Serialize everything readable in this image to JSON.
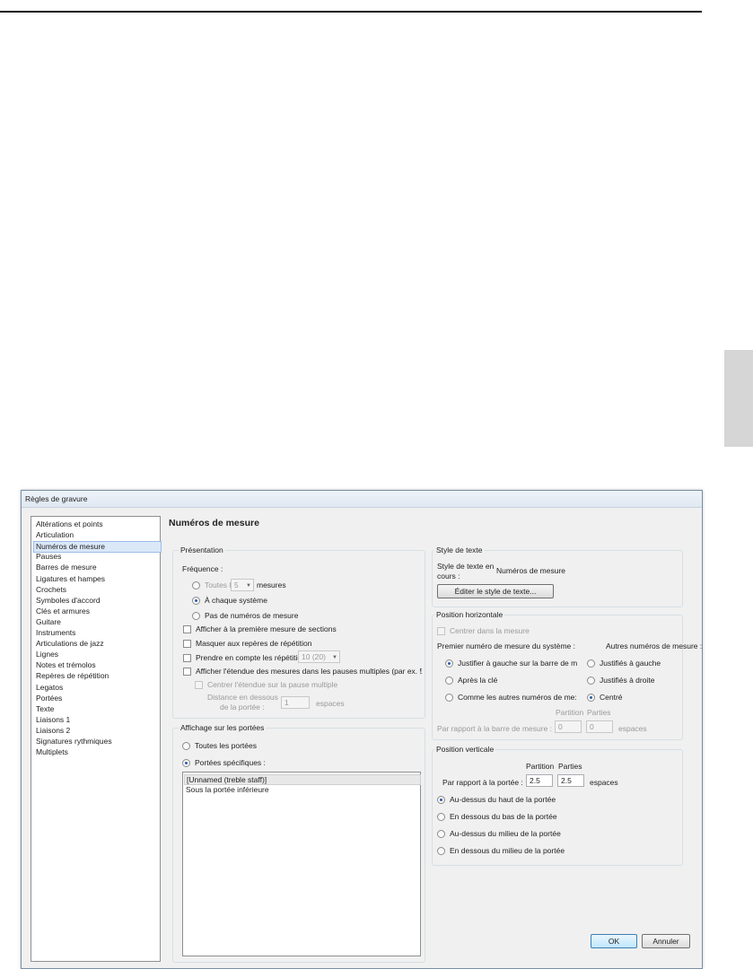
{
  "window": {
    "title": "Règles de gravure"
  },
  "nav": {
    "items": [
      "Altérations et points",
      "Articulation",
      "Numéros de mesure",
      "Pauses",
      "Barres de mesure",
      "Ligatures et hampes",
      "Crochets",
      "Symboles d'accord",
      "Clés et armures",
      "Guitare",
      "Instruments",
      "Articulations de jazz",
      "Lignes",
      "Notes et trémolos",
      "Repères de répétition",
      "Legatos",
      "Portées",
      "Texte",
      "Liaisons 1",
      "Liaisons 2",
      "Signatures rythmiques",
      "Multiplets"
    ],
    "selected_index": 2
  },
  "page": {
    "title": "Numéros de mesure"
  },
  "presentation": {
    "label": "Présentation",
    "frequence_label": "Fréquence :",
    "toutes_les": "Toutes les",
    "toutes_les_value": "5",
    "mesures": "mesures",
    "chaque_systeme": "À chaque système",
    "pas_de_numeros": "Pas de numéros de mesure",
    "afficher_premiere": "Afficher à la première mesure de sections",
    "masquer_reperes": "Masquer aux repères de répétition",
    "prendre_repetitions": "Prendre en compte les répétitions :",
    "repetitions_value": "10 (20)",
    "afficher_etendue": "Afficher l'étendue des mesures dans les pauses multiples (par ex. 5",
    "centrer_etendue": "Centrer l'étendue sur la pause multiple",
    "distance_line1": "Distance en dessous",
    "distance_line2": "de la portée :",
    "distance_value": "1",
    "espaces": "espaces"
  },
  "affichage": {
    "label": "Affichage sur les portées",
    "toutes_portees": "Toutes les portées",
    "portees_specifiques": "Portées spécifiques :",
    "list": [
      "[Unnamed (treble staff)]",
      "Sous la portée inférieure"
    ]
  },
  "style_texte": {
    "label": "Style de texte",
    "courant_line1": "Style de texte en",
    "courant_line2": "cours :",
    "courant_value": "Numéros de mesure",
    "edit_button": "Éditer le style de texte..."
  },
  "position_horizontale": {
    "label": "Position horizontale",
    "centrer": "Centrer dans la mesure",
    "premier_label": "Premier numéro de mesure du système :",
    "autres_label": "Autres numéros de mesure :",
    "premier_opts": [
      "Justifier à gauche sur la barre de m",
      "Après la clé",
      "Comme les autres numéros de me:"
    ],
    "autres_opts": [
      "Justifiés à gauche",
      "Justifiés à droite",
      "Centré"
    ],
    "col_partition": "Partition",
    "col_parties": "Parties",
    "par_rapport": "Par rapport à la barre de mesure :",
    "val_partition": "0",
    "val_parties": "0",
    "espaces": "espaces"
  },
  "position_verticale": {
    "label": "Position verticale",
    "col_partition": "Partition",
    "col_parties": "Parties",
    "par_rapport": "Par rapport à la portée :",
    "val_partition": "2.5",
    "val_parties": "2.5",
    "espaces": "espaces",
    "opts": [
      "Au-dessus du haut de la portée",
      "En dessous du bas de la portée",
      "Au-dessus du milieu de la portée",
      "En dessous du milieu de la portée"
    ]
  },
  "buttons": {
    "ok": "OK",
    "cancel": "Annuler"
  }
}
